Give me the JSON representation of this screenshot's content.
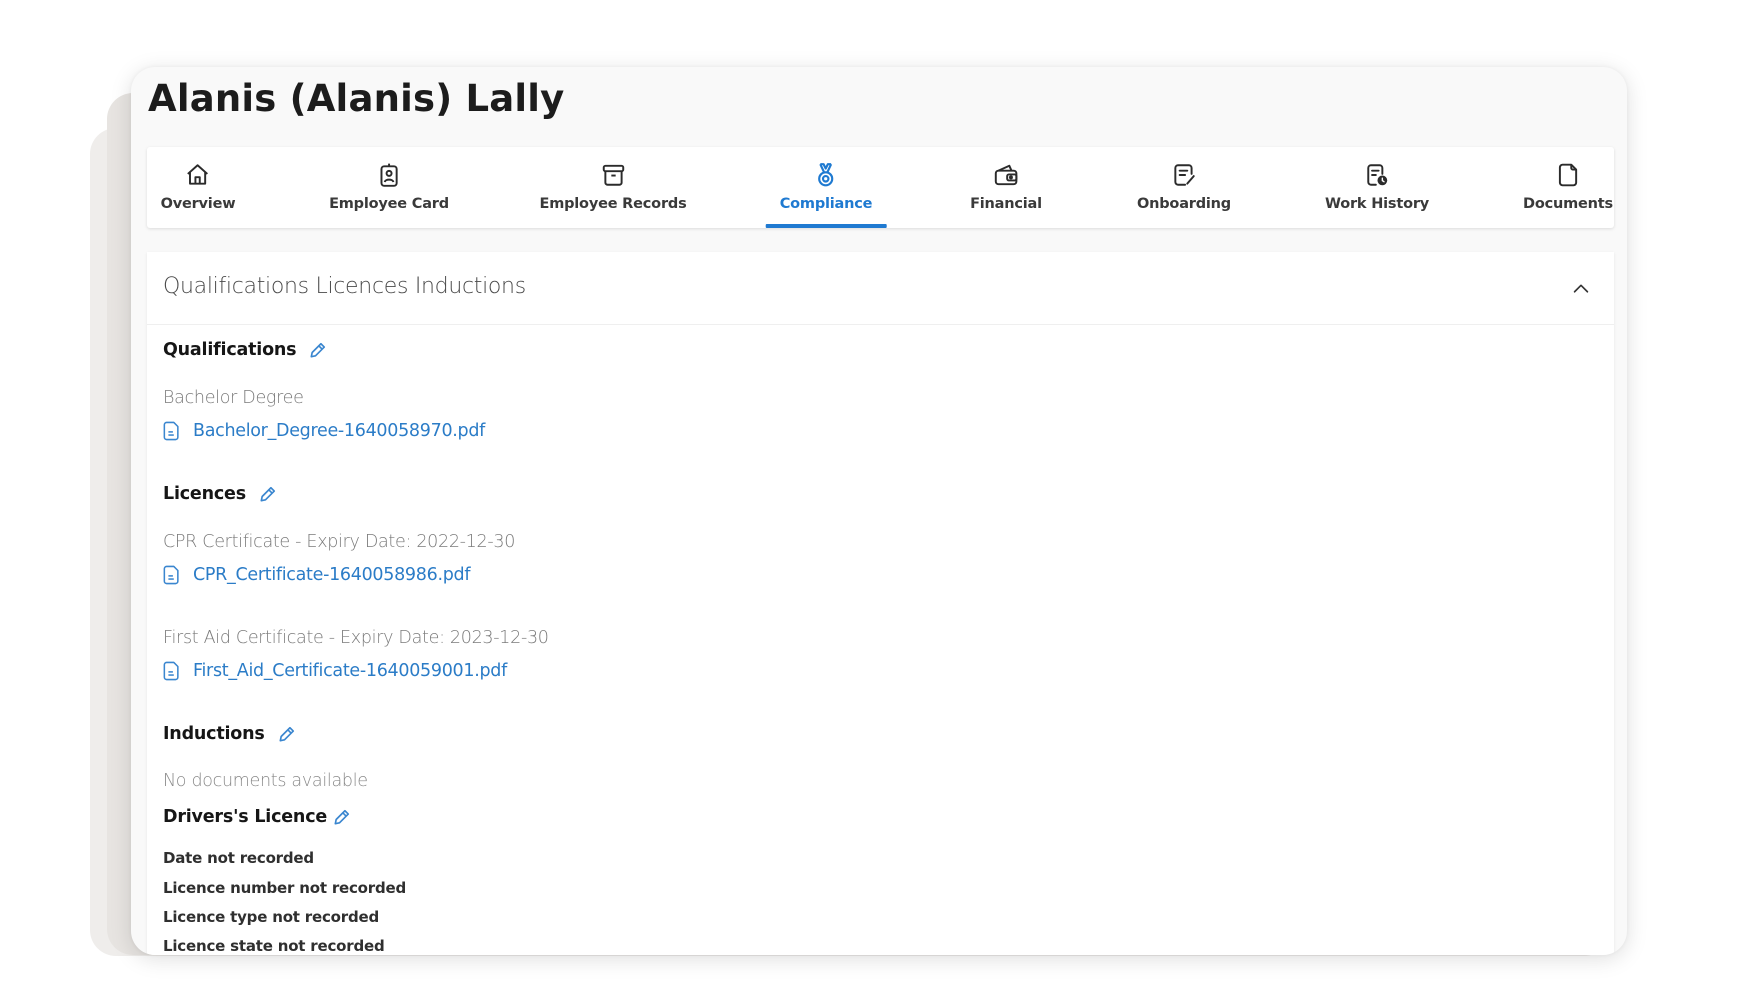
{
  "employee": {
    "name": "Alanis (Alanis) Lally"
  },
  "tabs": [
    {
      "label": "Overview",
      "icon": "home-icon"
    },
    {
      "label": "Employee Card",
      "icon": "id-badge-icon"
    },
    {
      "label": "Employee Records",
      "icon": "archive-box-icon"
    },
    {
      "label": "Compliance",
      "icon": "medal-icon",
      "active": true
    },
    {
      "label": "Financial",
      "icon": "wallet-icon"
    },
    {
      "label": "Onboarding",
      "icon": "edit-document-icon"
    },
    {
      "label": "Work History",
      "icon": "document-clock-icon"
    },
    {
      "label": "Documents",
      "icon": "file-icon"
    }
  ],
  "colors": {
    "accent": "#1f7ad1",
    "link": "#2b7cc7"
  },
  "panel": {
    "title": "Qualifications Licences Inductions",
    "collapse_icon": "chevron-up-icon",
    "qualifications": {
      "heading": "Qualifications",
      "items": [
        {
          "label": "Bachelor Degree",
          "file": "Bachelor_Degree-1640058970.pdf"
        }
      ]
    },
    "licences": {
      "heading": "Licences",
      "items": [
        {
          "label": "CPR Certificate - Expiry Date: 2022-12-30",
          "file": "CPR_Certificate-1640058986.pdf"
        },
        {
          "label": "First Aid Certificate - Expiry Date: 2023-12-30",
          "file": "First_Aid_Certificate-1640059001.pdf"
        }
      ]
    },
    "inductions": {
      "heading": "Inductions",
      "empty_text": "No documents available"
    },
    "drivers_licence": {
      "heading": "Drivers's Licence",
      "details": [
        "Date not recorded",
        "Licence number not recorded",
        "Licence type not recorded",
        "Licence state not recorded"
      ]
    }
  }
}
